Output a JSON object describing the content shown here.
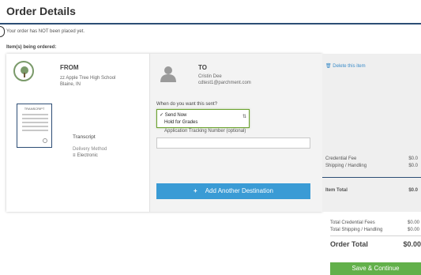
{
  "page": {
    "title": "Order Details",
    "notice": "Your order has NOT been placed yet.",
    "items_label": "Item(s) being ordered:"
  },
  "from": {
    "label": "FROM",
    "school_name": "zz Apple Tree High School",
    "school_location": "Blaine, IN",
    "logo_icon": "tree-seal-icon"
  },
  "document": {
    "thumb_title": "TRANSCRIPT",
    "label": "Transcript",
    "delivery_method_label": "Delivery Method",
    "delivery_method_value": "Electronic",
    "delivery_icon": "rss-icon"
  },
  "to": {
    "label": "TO",
    "name": "Cristin Dee",
    "email": "cdtest1@parchment.com",
    "avatar_icon": "user-avatar-icon",
    "when_label": "When do you want this sent?",
    "send_options": [
      "Send Now",
      "Hold for Grades"
    ],
    "selected_option": "Send Now",
    "tracking_label": "Application Tracking Number (optional)",
    "tracking_value": "",
    "add_destination": "Add Another Destination"
  },
  "summary": {
    "delete_item": "Delete this item",
    "credential_fee_label": "Credential Fee",
    "credential_fee_value": "$0.0",
    "shipping_label": "Shipping / Handling",
    "shipping_value": "$0.0",
    "item_total_label": "Item Total",
    "item_total_value": "$0.0"
  },
  "totals": {
    "credential_fees_label": "Total Credential Fees",
    "credential_fees_value": "$0.00",
    "shipping_label": "Total Shipping / Handling",
    "shipping_value": "$0.00",
    "order_total_label": "Order Total",
    "order_total_value": "$0.00",
    "save_button": "Save & Continue"
  },
  "colors": {
    "header_rule": "#2c4d75",
    "add_button": "#3a9bd5",
    "save_button": "#62b04a",
    "link": "#3a8bc8"
  }
}
